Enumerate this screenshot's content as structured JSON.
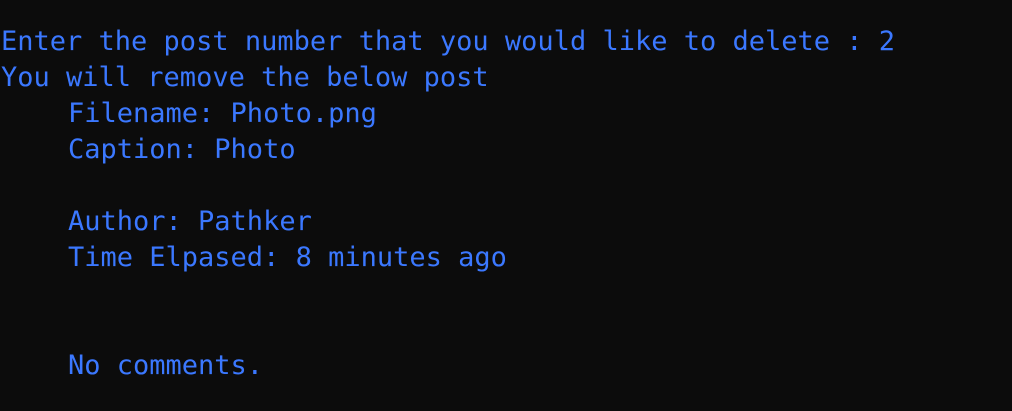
{
  "terminal": {
    "text_color": "#3b78ff",
    "background_color": "#0c0c0c",
    "prompt": "Enter the post number that you would like to delete : 2",
    "notice": "You will remove the below post",
    "post": {
      "filename": "Filename: Photo.png",
      "caption": "Caption: Photo",
      "author": "Author: Pathker",
      "time": "Time Elpased: 8 minutes ago"
    },
    "comments": "No comments."
  }
}
